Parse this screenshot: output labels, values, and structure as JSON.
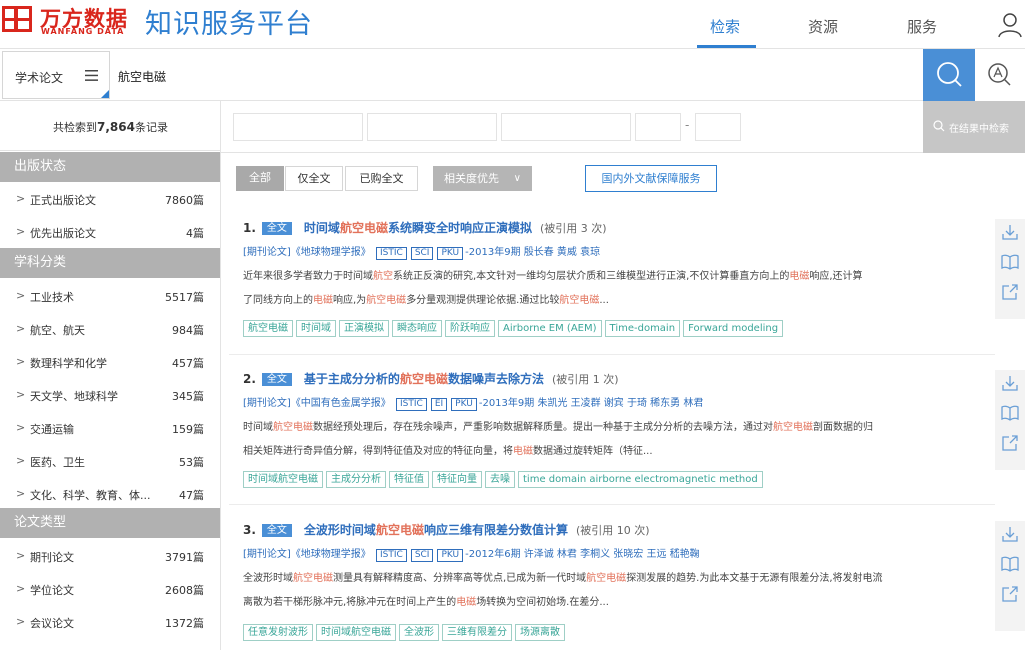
{
  "header": {
    "brand_cn": "万方数据",
    "brand_en": "WANFANG DATA",
    "platform_title": "知识服务平台",
    "nav": [
      {
        "label": "检索",
        "active": true
      },
      {
        "label": "资源",
        "active": false
      },
      {
        "label": "服务",
        "active": false
      }
    ],
    "user_icon": "user-icon"
  },
  "search": {
    "scope_label": "学术论文",
    "query": "航空电磁",
    "search_icon": "search-icon",
    "advanced_icon": "advanced-search-icon"
  },
  "sidebar": {
    "total_prefix": "共检索到",
    "total_count": "7,864",
    "total_suffix": "条记录",
    "groups": [
      {
        "title": "出版状态",
        "items": [
          {
            "label": "正式出版论文",
            "count": "7860篇"
          },
          {
            "label": "优先出版论文",
            "count": "4篇"
          }
        ]
      },
      {
        "title": "学科分类",
        "items": [
          {
            "label": "工业技术",
            "count": "5517篇"
          },
          {
            "label": "航空、航天",
            "count": "984篇"
          },
          {
            "label": "数理科学和化学",
            "count": "457篇"
          },
          {
            "label": "天文学、地球科学",
            "count": "345篇"
          },
          {
            "label": "交通运输",
            "count": "159篇"
          },
          {
            "label": "医药、卫生",
            "count": "53篇"
          },
          {
            "label": "文化、科学、教育、体...",
            "count": "47篇"
          }
        ]
      },
      {
        "title": "论文类型",
        "items": [
          {
            "label": "期刊论文",
            "count": "3791篇"
          },
          {
            "label": "学位论文",
            "count": "2608篇"
          },
          {
            "label": "会议论文",
            "count": "1372篇"
          }
        ]
      }
    ]
  },
  "filters": {
    "range_dash": "-",
    "in_result_search": "在结果中检索"
  },
  "tabs": {
    "all": "全部",
    "fulltext_only": "仅全文",
    "purchased": "已购全文",
    "sort": "相关度优先",
    "doc_service": "国内外文献保障服务"
  },
  "results": [
    {
      "num": "1.",
      "tag": "全文",
      "title_pre": "时间域",
      "title_hl": "航空电磁",
      "title_post": "系统瞬变全时响应正演模拟",
      "cite": "(被引用 3 次)",
      "meta_pre": "[期刊论文]《地球物理学报》",
      "indexes": [
        "ISTIC",
        "SCI",
        "PKU"
      ],
      "meta_post": "-2013年9期 殷长春 黄威 袁琼",
      "abs1_pre": "近年来很多学者致力于时间域",
      "abs1_hl1": "航空",
      "abs1_mid": "系统正反演的研究,本文针对一维均匀层状介质和三维模型进行正演,不仅计算垂直方向上的",
      "abs1_hl2": "电磁",
      "abs1_post": "响应,还计算",
      "abs2_pre": "了同线方向上的",
      "abs2_hl1": "电磁",
      "abs2_mid": "响应,为",
      "abs2_hl2": "航空电磁",
      "abs2_mid2": "多分量观测提供理论依据.通过比较",
      "abs2_hl3": "航空电磁",
      "abs2_post": "...",
      "keywords": [
        "航空电磁",
        "时间域",
        "正演模拟",
        "瞬态响应",
        "阶跃响应",
        "Airborne EM (AEM)",
        "Time-domain",
        "Forward modeling"
      ]
    },
    {
      "num": "2.",
      "tag": "全文",
      "title_pre": "基于主成分分析的",
      "title_hl": "航空电磁",
      "title_post": "数据噪声去除方法",
      "cite": "(被引用 1 次)",
      "meta_pre": "[期刊论文]《中国有色金属学报》",
      "indexes": [
        "ISTIC",
        "EI",
        "PKU"
      ],
      "meta_post": "-2013年9期 朱凯光 王凌群 谢宾 于琦 稀东勇 林君",
      "abs1_pre": "时间域",
      "abs1_hl1": "航空电磁",
      "abs1_mid": "数据经预处理后，存在残余噪声，严重影响数据解释质量。提出一种基于主成分分析的去噪方法，通过对",
      "abs1_hl2": "航空电磁",
      "abs1_post": "剖面数据的归",
      "abs2_pre": "相关矩阵进行奇异值分解，得到特征值及对应的特征向量，将",
      "abs2_hl1": "电磁",
      "abs2_mid": "数据通过旋转矩阵（特征...",
      "abs2_hl2": "",
      "abs2_mid2": "",
      "abs2_hl3": "",
      "abs2_post": "",
      "keywords": [
        "时间域航空电磁",
        "主成分分析",
        "特征值",
        "特征向量",
        "去噪",
        "time domain airborne electromagnetic method"
      ]
    },
    {
      "num": "3.",
      "tag": "全文",
      "title_pre": "全波形时间域",
      "title_hl": "航空电磁",
      "title_post": "响应三维有限差分数值计算",
      "cite": "(被引用 10 次)",
      "meta_pre": "[期刊论文]《地球物理学报》",
      "indexes": [
        "ISTIC",
        "SCI",
        "PKU"
      ],
      "meta_post": "-2012年6期 许泽诚 林君 李桐义 张晓宏 王远 嵇艳鞠",
      "abs1_pre": "全波形时域",
      "abs1_hl1": "航空电磁",
      "abs1_mid": "测量具有解释精度高、分辨率高等优点,已成为新一代时域",
      "abs1_hl2": "航空电磁",
      "abs1_post": "探测发展的趋势.为此本文基于无源有限差分法,将发射电流",
      "abs2_pre": "离散为若干梯形脉冲元,将脉冲元在时间上产生的",
      "abs2_hl1": "电磁",
      "abs2_mid": "场转换为空间初始场.在差分...",
      "abs2_hl2": "",
      "abs2_mid2": "",
      "abs2_hl3": "",
      "abs2_post": "",
      "keywords": [
        "任意发射波形",
        "时间域航空电磁",
        "全波形",
        "三维有限差分",
        "场源离散"
      ]
    }
  ],
  "result_actions": {
    "download_icon": "download-icon",
    "read_icon": "book-icon",
    "export_icon": "export-icon"
  },
  "colors": {
    "brand_red": "#d9261c",
    "accent_blue": "#2f7fd0",
    "highlight": "#e2725b",
    "keyword_green": "#3aa698"
  }
}
